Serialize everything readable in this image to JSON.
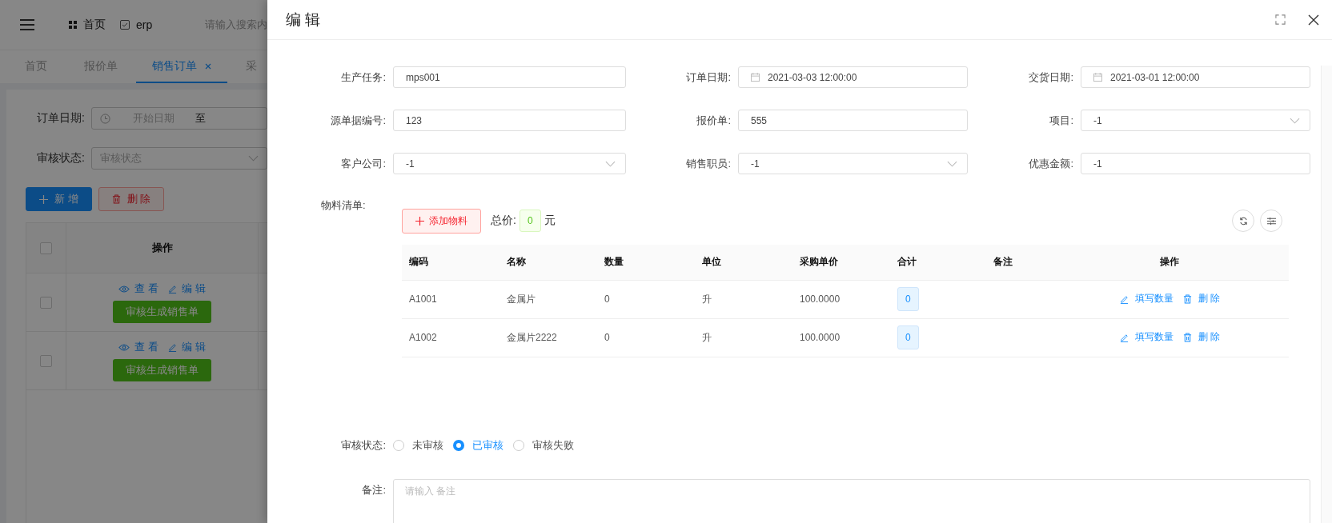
{
  "background_page": {
    "breadcrumbs": [
      {
        "label": "首页"
      },
      {
        "label": "erp"
      }
    ],
    "search": {
      "placeholder": "请输入搜索内"
    },
    "tabs": [
      {
        "label": "首页",
        "selected": false,
        "closable": false
      },
      {
        "label": "报价单",
        "selected": false,
        "closable": false
      },
      {
        "label": "销售订单",
        "selected": true,
        "closable": true
      },
      {
        "label": "采",
        "selected": false,
        "closable": false
      }
    ],
    "filters": [
      {
        "label": "订单日期:",
        "kind": "daterange",
        "start_placeholder": "开始日期",
        "separator": "至"
      },
      {
        "label": "审核状态:",
        "kind": "select",
        "placeholder": "审核状态"
      }
    ],
    "buttons": [
      {
        "label": "新 增",
        "kind": "primary"
      },
      {
        "label": "删 除",
        "kind": "danger"
      }
    ],
    "table": {
      "header_checked": false,
      "columns": [
        "操作"
      ],
      "rows": [
        {
          "checked": false,
          "actions": [
            "查 看",
            "编 辑"
          ],
          "button": "审核生成销售单"
        },
        {
          "checked": false,
          "actions": [
            "查 看",
            "编 辑"
          ],
          "button": "审核生成销售单"
        }
      ]
    }
  },
  "drawer": {
    "title": "编 辑",
    "fields": [
      {
        "label": "生产任务:",
        "kind": "input",
        "value": "mps001"
      },
      {
        "label": "订单日期:",
        "kind": "date",
        "value": "2021-03-03 12:00:00"
      },
      {
        "label": "交货日期:",
        "kind": "date",
        "value": "2021-03-01 12:00:00"
      },
      {
        "label": "源单据编号:",
        "kind": "input",
        "value": "123"
      },
      {
        "label": "报价单:",
        "kind": "input",
        "value": "555"
      },
      {
        "label": "项目:",
        "kind": "select",
        "value": "-1"
      },
      {
        "label": "客户公司:",
        "kind": "select",
        "value": "-1"
      },
      {
        "label": "销售职员:",
        "kind": "select",
        "value": "-1"
      },
      {
        "label": "优惠金额:",
        "kind": "input",
        "value": "-1"
      }
    ],
    "materials": {
      "label": "物料清单:",
      "add_button": "添加物料",
      "total_label": "总价:",
      "total": "0",
      "currency": "元",
      "columns": [
        "编码",
        "名称",
        "数量",
        "单位",
        "采购单价",
        "合计",
        "备注",
        "操作"
      ],
      "rows": [
        {
          "code": "A1001",
          "name": "金属片",
          "quantity": "0",
          "unit": "升",
          "price": "100.0000",
          "total": "0",
          "actions": [
            "填写数量",
            "删 除"
          ]
        },
        {
          "code": "A1002",
          "name": "金属片2222",
          "quantity": "0",
          "unit": "升",
          "price": "100.0000",
          "total": "0",
          "actions": [
            "填写数量",
            "删 除"
          ]
        }
      ]
    },
    "audit_status": {
      "label": "审核状态:",
      "options": [
        {
          "label": "未审核",
          "selected": false
        },
        {
          "label": "已审核",
          "selected": true
        },
        {
          "label": "审核失败",
          "selected": false
        }
      ]
    },
    "remark": {
      "label": "备注:",
      "placeholder": "请输入 备注"
    }
  }
}
